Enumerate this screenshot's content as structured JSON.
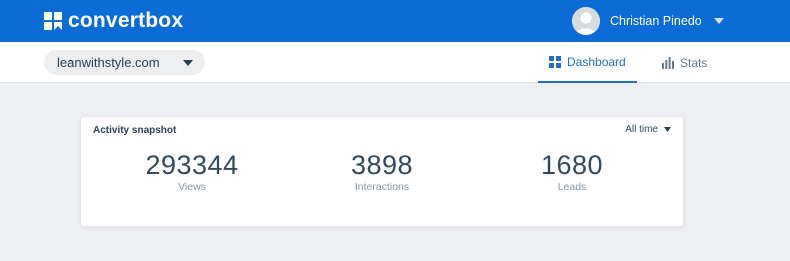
{
  "header": {
    "brand": "convertbox",
    "user_name": "Christian Pinedo",
    "brand_color": "#0c6cd6"
  },
  "subnav": {
    "site": "leanwithstyle.com",
    "tabs": [
      {
        "label": "Dashboard",
        "icon": "dashboard-grid-icon",
        "active": true
      },
      {
        "label": "Stats",
        "icon": "bar-chart-icon",
        "active": false
      }
    ]
  },
  "snapshot": {
    "title": "Activity snapshot",
    "range": "All time",
    "stats": [
      {
        "value": "293344",
        "label": "Views"
      },
      {
        "value": "3898",
        "label": "Interactions"
      },
      {
        "value": "1680",
        "label": "Leads"
      }
    ]
  }
}
